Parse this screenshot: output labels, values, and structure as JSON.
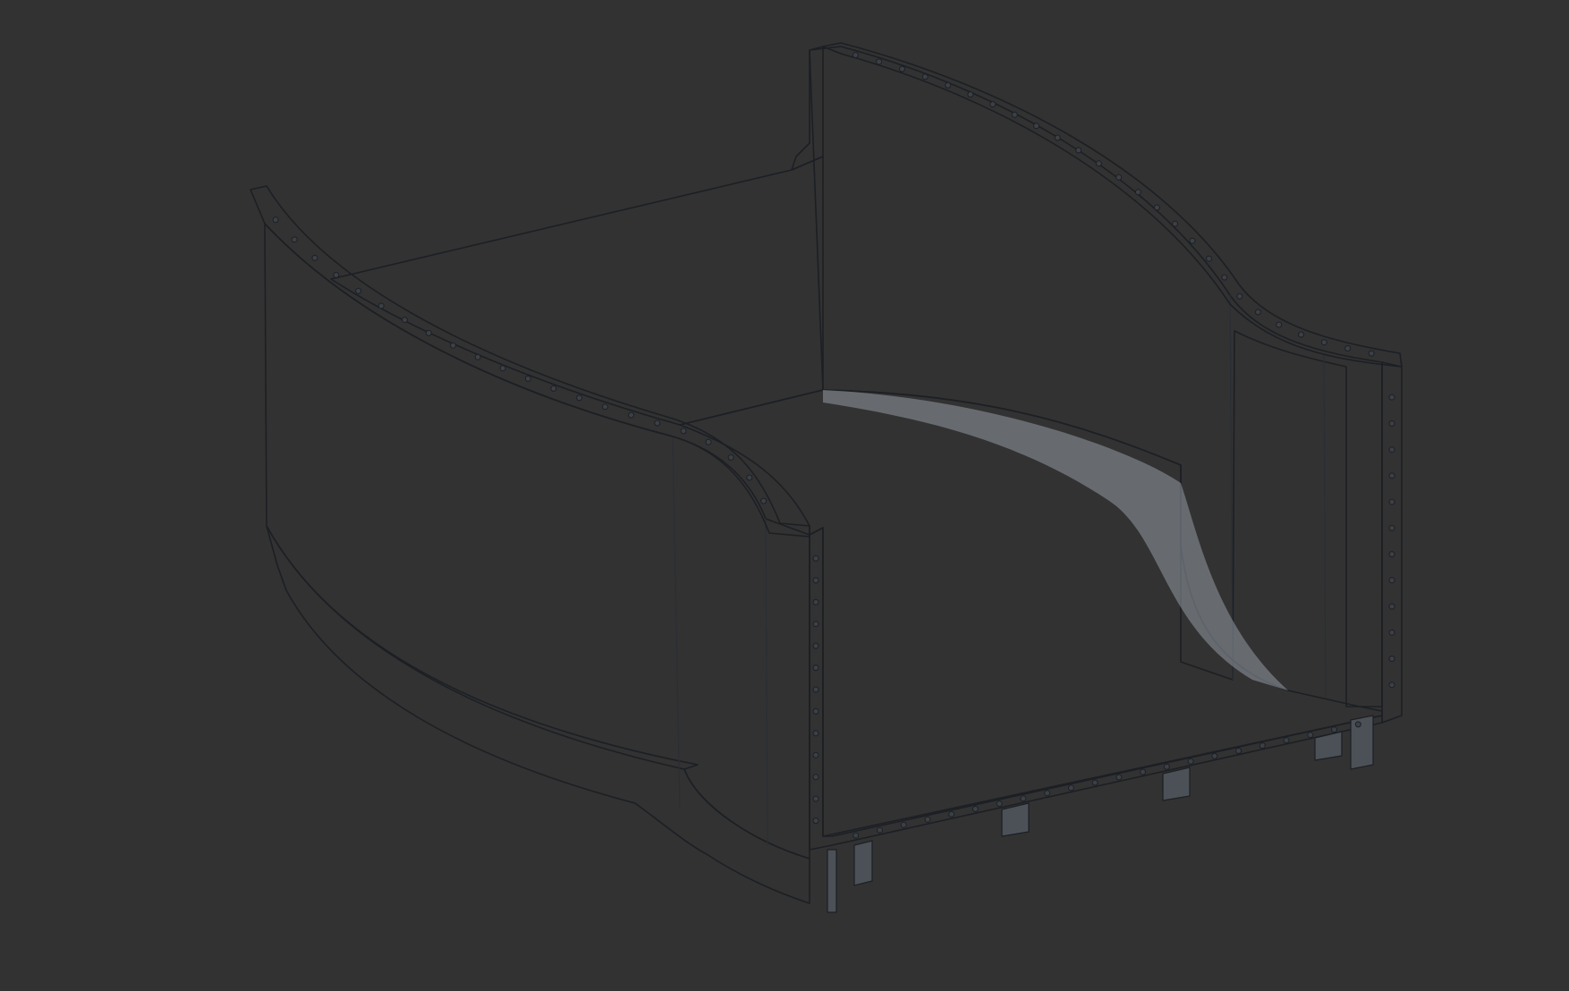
{
  "viewport": {
    "background": "#323232",
    "model": {
      "colors": {
        "outer_wall": "#5b5f66",
        "outer_wall_dark": "#53575e",
        "inner_wall": "#8a9099",
        "floor": "#a3abb4",
        "side_panel": "#5c6068",
        "flange": "#aab1ba",
        "edge": "#1c1f24"
      },
      "icon": "sheet-metal-enclosure-icon"
    }
  }
}
